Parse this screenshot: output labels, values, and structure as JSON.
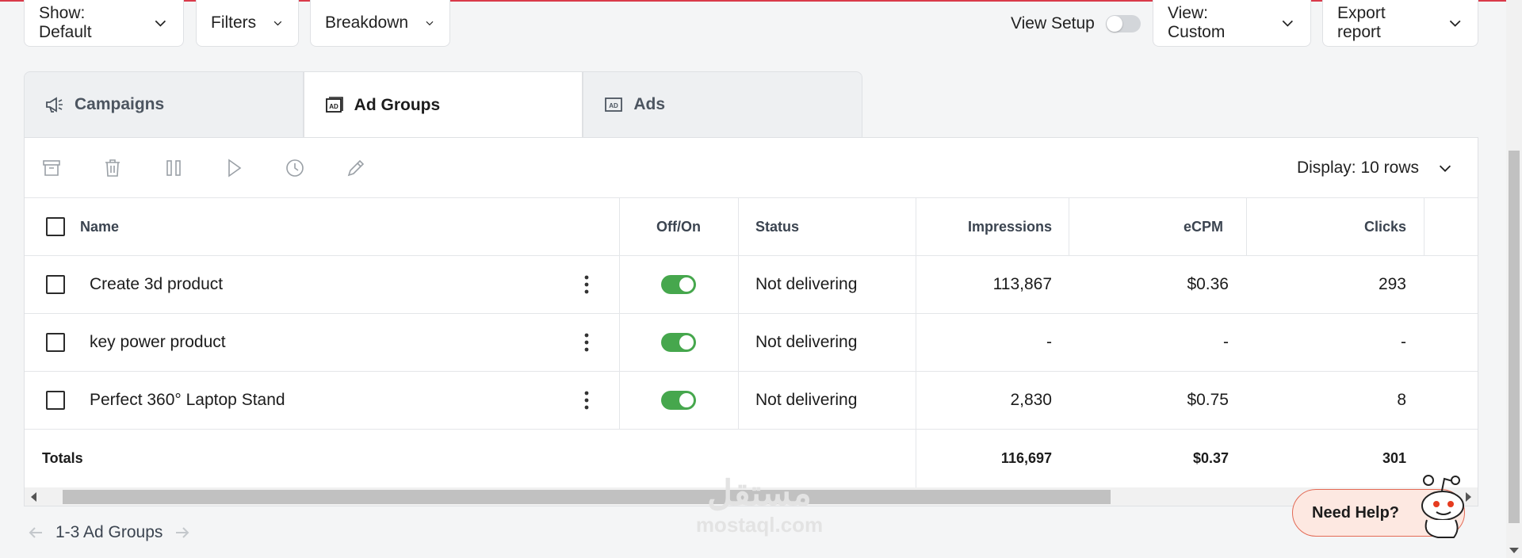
{
  "toolbar": {
    "show_label": "Show: Default",
    "filters_label": "Filters",
    "breakdown_label": "Breakdown",
    "view_setup_label": "View Setup",
    "view_label": "View: Custom",
    "export_label": "Export report"
  },
  "tabs": [
    {
      "label": "Campaigns",
      "icon": "megaphone-icon",
      "active": false
    },
    {
      "label": "Ad Groups",
      "icon": "ad-group-icon",
      "active": true
    },
    {
      "label": "Ads",
      "icon": "ad-icon",
      "active": false
    }
  ],
  "actions": [
    "archive-icon",
    "trash-icon",
    "pause-icon",
    "play-icon",
    "clock-icon",
    "pencil-icon"
  ],
  "display_label": "Display: 10 rows",
  "table": {
    "headers": {
      "name": "Name",
      "onoff": "Off/On",
      "status": "Status",
      "impressions": "Impressions",
      "ecpm": "eCPM",
      "clicks": "Clicks"
    },
    "rows": [
      {
        "name": "Create 3d product",
        "on": true,
        "status": "Not delivering",
        "impressions": "113,867",
        "ecpm": "$0.36",
        "clicks": "293"
      },
      {
        "name": "key power product",
        "on": true,
        "status": "Not delivering",
        "impressions": "-",
        "ecpm": "-",
        "clicks": "-"
      },
      {
        "name": "Perfect 360° Laptop Stand",
        "on": true,
        "status": "Not delivering",
        "impressions": "2,830",
        "ecpm": "$0.75",
        "clicks": "8"
      }
    ],
    "totals": {
      "label": "Totals",
      "impressions": "116,697",
      "ecpm": "$0.37",
      "clicks": "301"
    }
  },
  "pager": {
    "text": "1-3 Ad Groups"
  },
  "watermark": {
    "arabic": "مستقل",
    "latin": "mostaql.com"
  },
  "help": {
    "label": "Need Help?"
  },
  "colors": {
    "accent_red": "#d93a4a",
    "toggle_on": "#46a74d",
    "help_bg": "#fde8e1"
  }
}
